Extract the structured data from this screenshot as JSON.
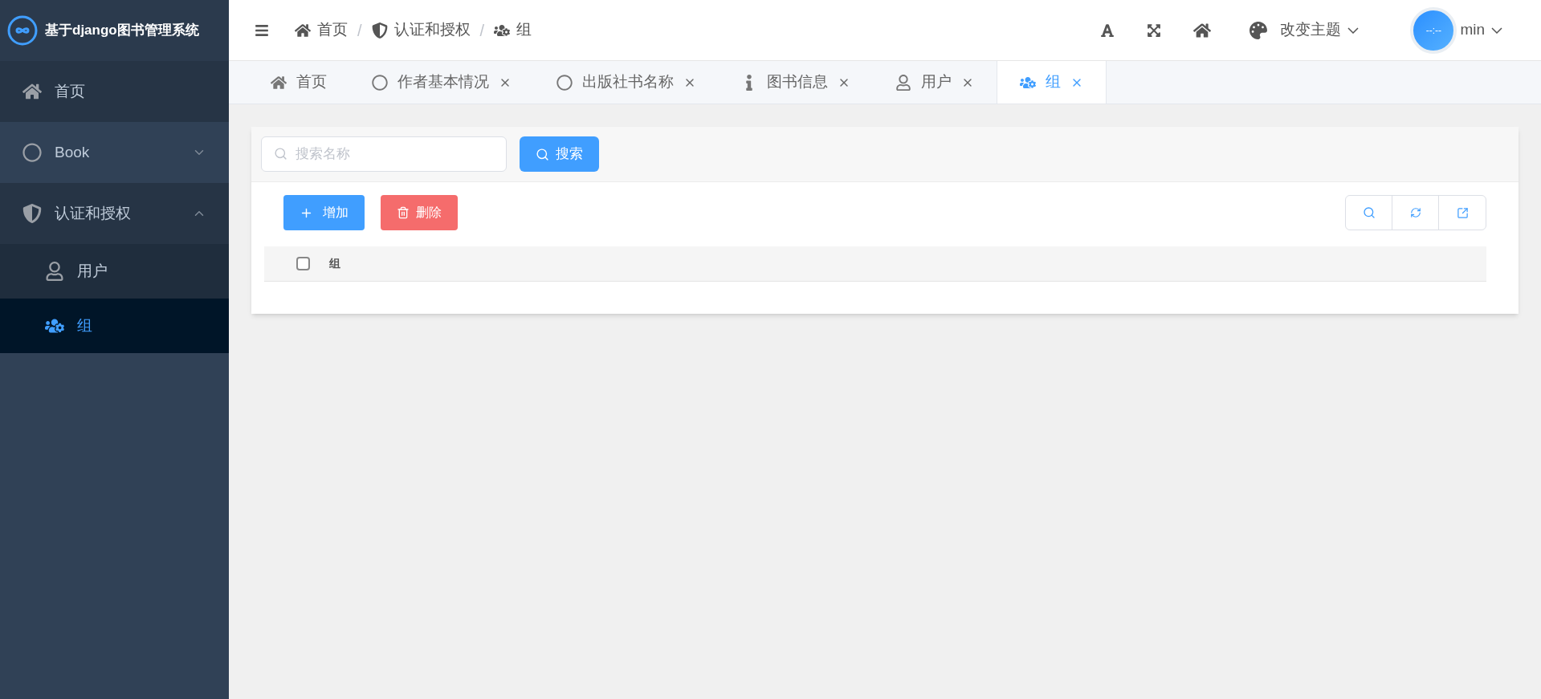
{
  "sidebar": {
    "title": "基于django图书管理系统",
    "menu": [
      {
        "label": "首页",
        "selected": false
      },
      {
        "label": "Book",
        "selected": false,
        "expanded": false
      },
      {
        "label": "认证和授权",
        "selected": false,
        "expanded": true,
        "children": [
          {
            "label": "用户",
            "selected": false
          },
          {
            "label": "组",
            "selected": true
          }
        ]
      }
    ]
  },
  "header": {
    "breadcrumb": [
      "首页",
      "认证和授权",
      "组"
    ],
    "separator": "/",
    "theme": "改变主题",
    "avatar_text": "--:--",
    "user": "min"
  },
  "tabs": [
    {
      "label": "首页",
      "selected": false,
      "closable": false
    },
    {
      "label": "作者基本情况",
      "selected": false,
      "closable": true
    },
    {
      "label": "出版社书名称",
      "selected": false,
      "closable": true
    },
    {
      "label": "图书信息",
      "selected": false,
      "closable": true
    },
    {
      "label": "用户",
      "selected": false,
      "closable": true
    },
    {
      "label": "组",
      "selected": true,
      "closable": true
    }
  ],
  "search": {
    "placeholder": "搜索名称",
    "button": "搜索"
  },
  "actions": {
    "add": "增加",
    "delete": "删除"
  },
  "table": {
    "all_checked": false,
    "columns": [
      "组"
    ]
  }
}
